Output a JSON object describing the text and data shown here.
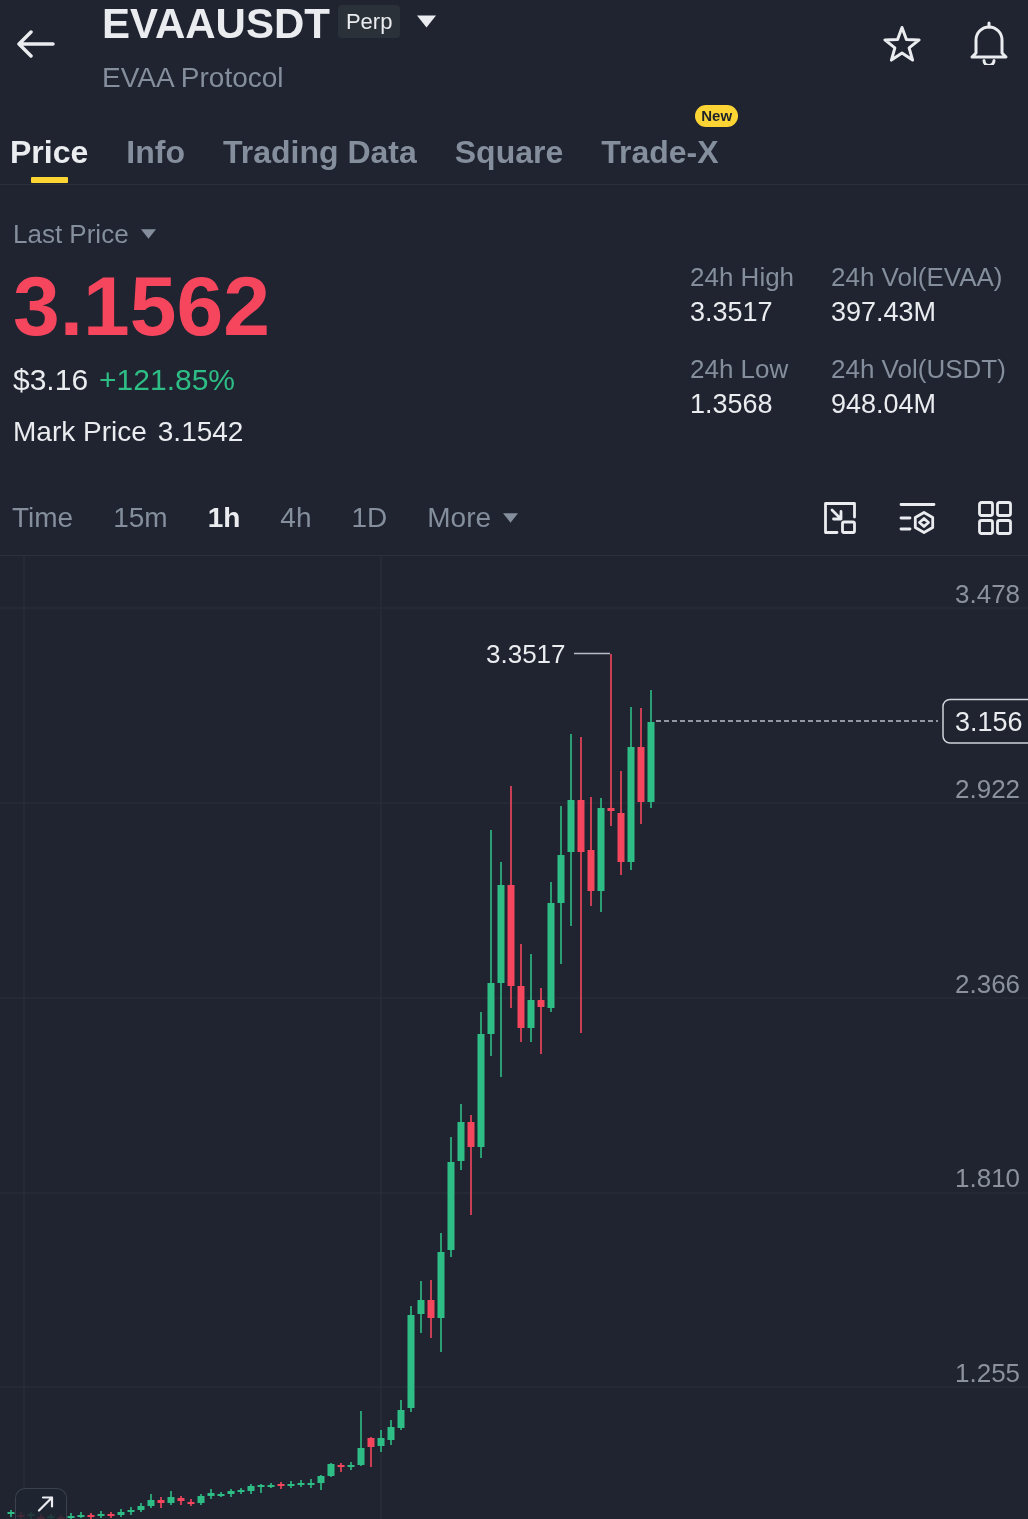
{
  "header": {
    "title": "EVAAUSDT",
    "contract_type": "Perp",
    "subtitle": "EVAA Protocol"
  },
  "tabs": [
    {
      "label": "Price",
      "selected": true
    },
    {
      "label": "Info",
      "selected": false
    },
    {
      "label": "Trading Data",
      "selected": false
    },
    {
      "label": "Square",
      "selected": false
    },
    {
      "label": "Trade-X",
      "selected": false,
      "badge": "New"
    }
  ],
  "price_summary": {
    "price_type": "Last Price",
    "last_price": "3.1562",
    "last_price_falling": true,
    "usd_price": "$3.16",
    "change_percent": "+121.85%",
    "change_positive": true,
    "mark_price_label": "Mark Price",
    "mark_price": "3.1542"
  },
  "stats": [
    {
      "label": "24h High",
      "value": "3.3517"
    },
    {
      "label": "24h Vol(EVAA)",
      "value": "397.43M"
    },
    {
      "label": "24h Low",
      "value": "1.3568"
    },
    {
      "label": "24h Vol(USDT)",
      "value": "948.04M"
    }
  ],
  "intervals": [
    {
      "label": "Time",
      "selected": false
    },
    {
      "label": "15m",
      "selected": false
    },
    {
      "label": "1h",
      "selected": true
    },
    {
      "label": "4h",
      "selected": false
    },
    {
      "label": "1D",
      "selected": false
    }
  ],
  "more_menu": {
    "label": "More"
  },
  "chart": {
    "y_axis_labels": [
      "3.478",
      "2.922",
      "2.366",
      "1.810",
      "1.255"
    ],
    "high_marker": "3.3517",
    "current_price_tag": "3.156"
  }
}
